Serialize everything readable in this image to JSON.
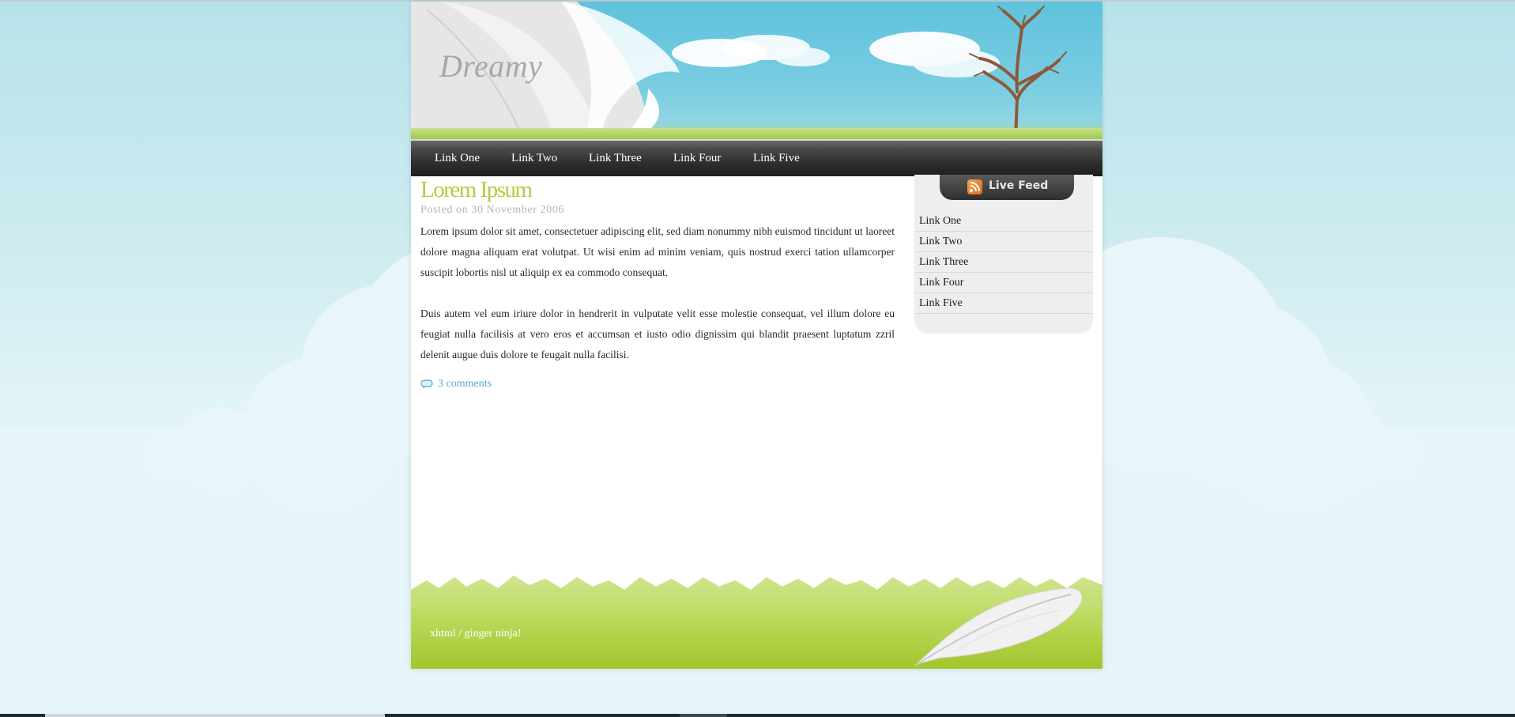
{
  "site": {
    "title": "Dreamy"
  },
  "nav": {
    "items": [
      "Link One",
      "Link Two",
      "Link Three",
      "Link Four",
      "Link Five"
    ]
  },
  "post": {
    "title": "Lorem Ipsum",
    "meta": "Posted on 30 November 2006",
    "paragraphs": [
      "Lorem ipsum dolor sit amet, consectetuer adipiscing elit, sed diam nonummy nibh euismod tincidunt ut laoreet dolore magna aliquam erat volutpat. Ut wisi enim ad minim veniam, quis nostrud exerci tation ullamcorper suscipit lobortis nisl ut aliquip ex ea commodo consequat.",
      "Duis autem vel eum iriure dolor in hendrerit in vulputate velit esse molestie consequat, vel illum dolore eu feugiat nulla facilisis at vero eros et accumsan et iusto odio dignissim qui blandit praesent luptatum zzril delenit augue duis dolore te feugait nulla facilisi."
    ],
    "comments_label": "3 comments"
  },
  "sidebar": {
    "live_feed_label": "Live Feed",
    "links": [
      "Link One",
      "Link Two",
      "Link Three",
      "Link Four",
      "Link Five"
    ]
  },
  "footer": {
    "text": "xhtml / ginger ninja!"
  },
  "colors": {
    "title_green": "#b3cc3e",
    "link_blue": "#56a7cf",
    "sky": "#5ec2dc",
    "grass": "#a7c935"
  }
}
